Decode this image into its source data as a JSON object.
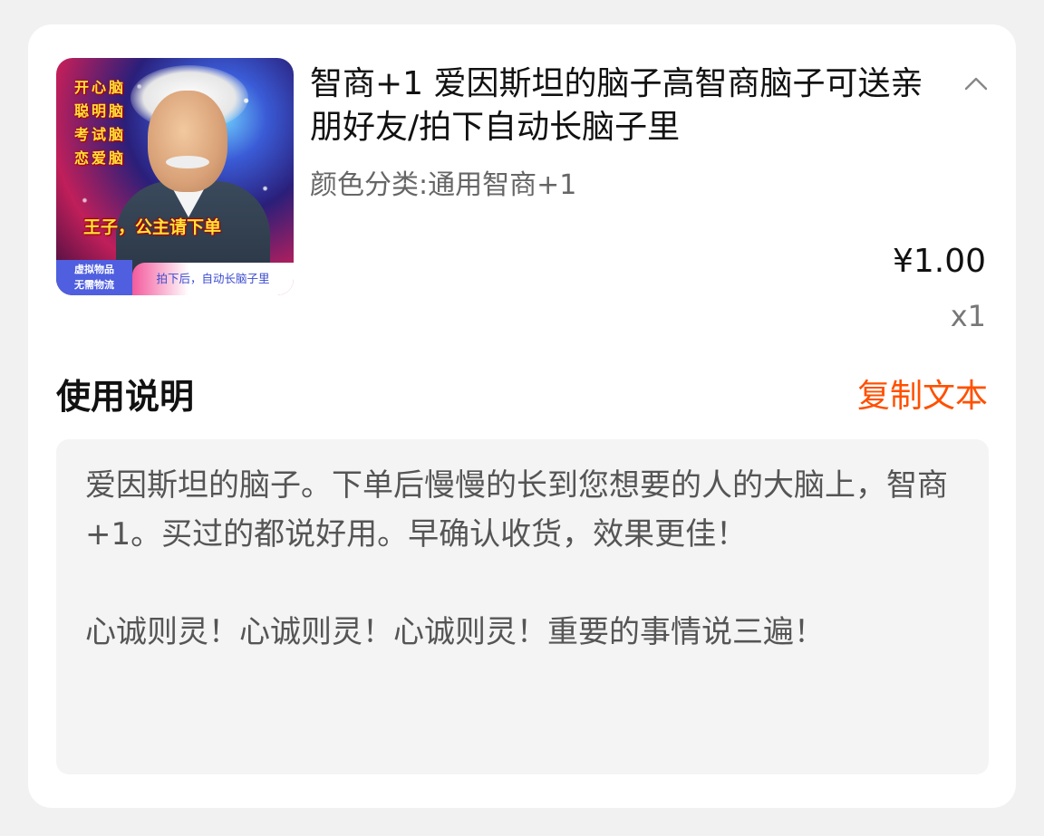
{
  "product": {
    "image": {
      "icon": "product-thumbnail-einstein",
      "side_lines": [
        "开心脑",
        "聪明脑",
        "考试脑",
        "恋爱脑"
      ],
      "banner": "王子，公主请下单",
      "badge_line1": "虚拟物品",
      "badge_line2": "无需物流",
      "badge_right": "拍下后，自动长脑子里"
    },
    "title": "智商+1 爱因斯坦的脑子高智商脑子可送亲朋好友/拍下自动长脑子里",
    "variant": "颜色分类:通用智商+1",
    "price": "¥1.00",
    "quantity": "x1",
    "collapse_icon": "chevron-up-icon"
  },
  "instructions": {
    "title": "使用说明",
    "copy_label": "复制文本",
    "paragraph1": "爱因斯坦的脑子。下单后慢慢的长到您想要的人的大脑上，智商+1。买过的都说好用。早确认收货，效果更佳！",
    "paragraph2": "心诚则灵！心诚则灵！心诚则灵！重要的事情说三遍！"
  },
  "colors": {
    "page_bg": "#f1f1f1",
    "card_bg": "#ffffff",
    "accent": "#ff5000",
    "desc_bg": "#f4f4f4"
  }
}
